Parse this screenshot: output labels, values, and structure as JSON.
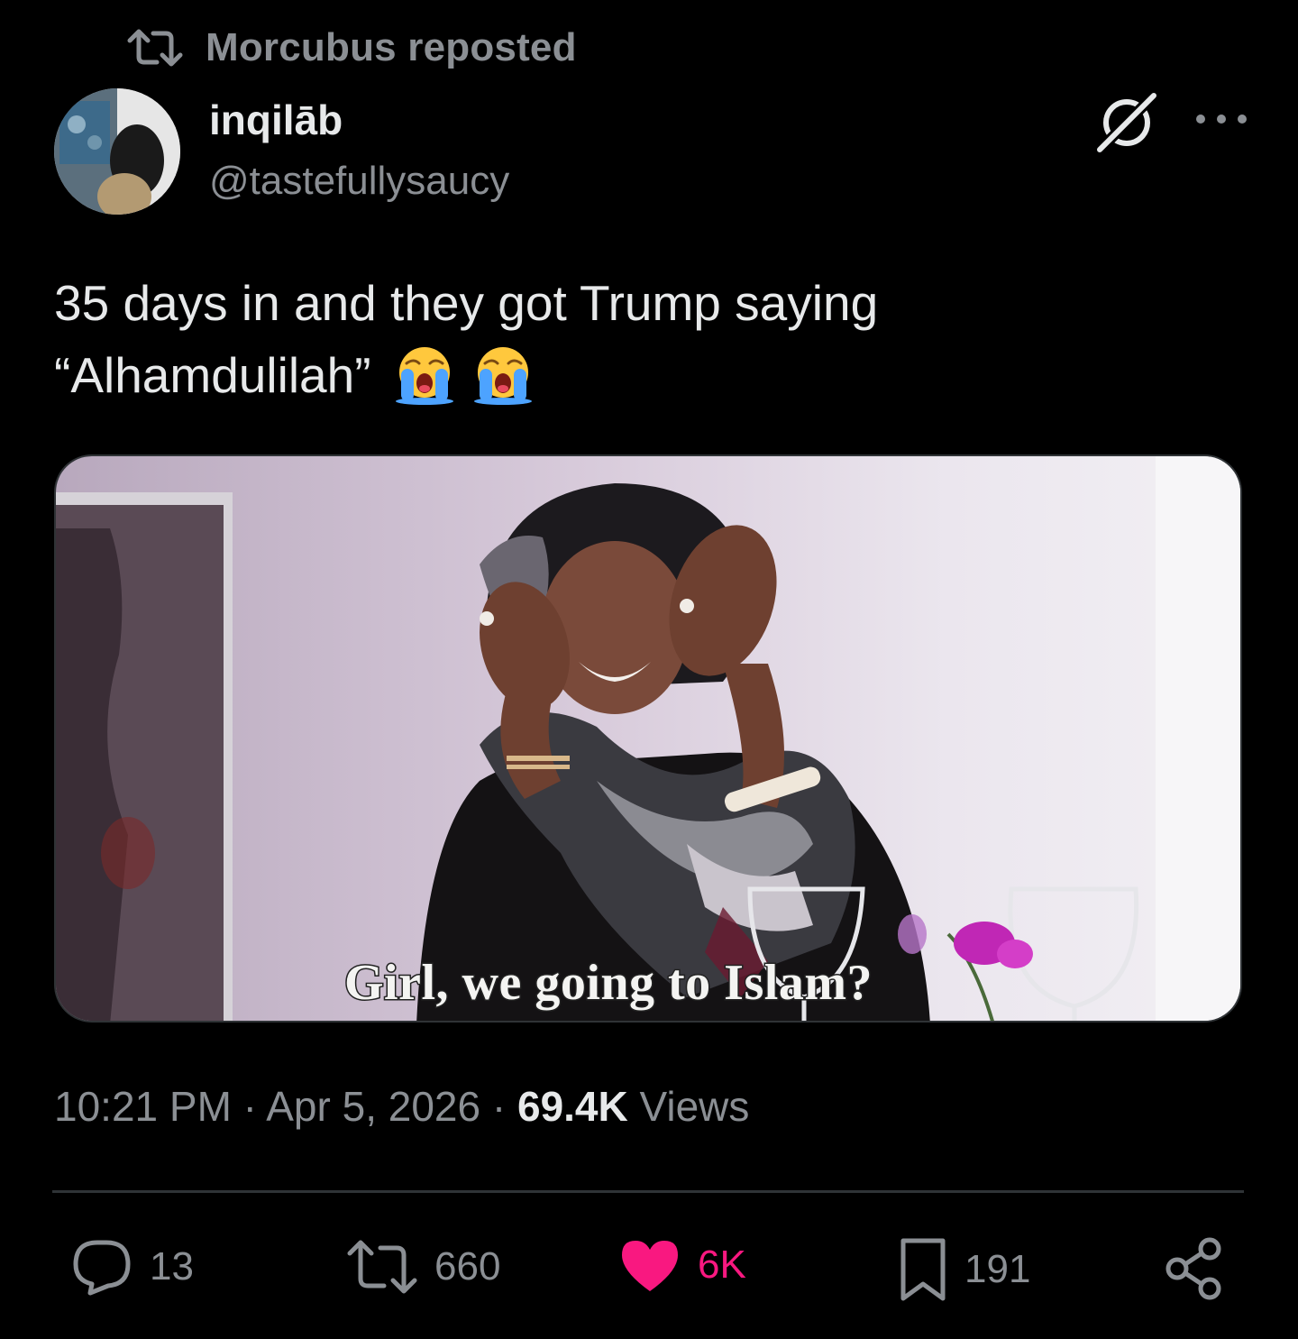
{
  "repost": {
    "text": "Morcubus reposted"
  },
  "author": {
    "display_name": "inqilāb",
    "handle": "@tastefullysaucy"
  },
  "tweet": {
    "line1": "35 days in and they got Trump saying",
    "line2": "“Alhamdulilah”",
    "emojis": [
      "loudly-crying-face-emoji",
      "loudly-crying-face-emoji"
    ]
  },
  "media": {
    "subtitle": "Girl, we going to Islam?"
  },
  "meta": {
    "time": "10:21 PM",
    "sep1": " · ",
    "date": "Apr 5, 2026",
    "sep2": " · ",
    "views_count": "69.4K",
    "views_label": " Views"
  },
  "actions": {
    "replies": "13",
    "reposts": "660",
    "likes": "6K",
    "bookmarks": "191"
  },
  "colors": {
    "background": "#000000",
    "text": "#e7e9ea",
    "muted": "#8b8f94",
    "like": "#f91880",
    "divider": "#2f3336"
  }
}
